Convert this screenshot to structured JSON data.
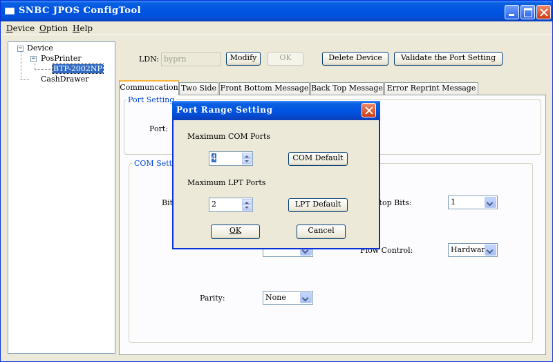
{
  "window": {
    "title": "SNBC JPOS ConfigTool"
  },
  "menu": {
    "device": "Device",
    "option": "Option",
    "help": "Help"
  },
  "tree": {
    "root": "Device",
    "pos_printer": "PosPrinter",
    "printer_model": "BTP-2002NP",
    "cash_drawer": "CashDrawer"
  },
  "toolbar": {
    "ldn_label": "LDN:",
    "ldn_value": "byprn",
    "modify": "Modify",
    "ok": "OK",
    "delete_device": "Delete Device",
    "validate": "Validate the Port Setting"
  },
  "tabs": [
    "Communcation",
    "Two Side",
    "Front Bottom Message",
    "Back Top Message",
    "Error Reprint Message"
  ],
  "port_setting": {
    "group_title": "Port Setting",
    "port_label": "Port:"
  },
  "com_setting": {
    "group_title": "COM Setting",
    "bits_label": "Bits",
    "stop_bits_label": "Stop Bits:",
    "stop_bits_value": "1",
    "flow_control_label": "Flow Control:",
    "flow_control_value": "Hardware",
    "parity_label": "Parity:",
    "parity_value": "None"
  },
  "dialog": {
    "title": "Port Range Setting",
    "max_com_label": "Maximum COM Ports",
    "max_com_value": "4",
    "com_default": "COM Default",
    "max_lpt_label": "Maximum LPT Ports",
    "max_lpt_value": "2",
    "lpt_default": "LPT Default",
    "ok": "OK",
    "cancel": "Cancel"
  }
}
